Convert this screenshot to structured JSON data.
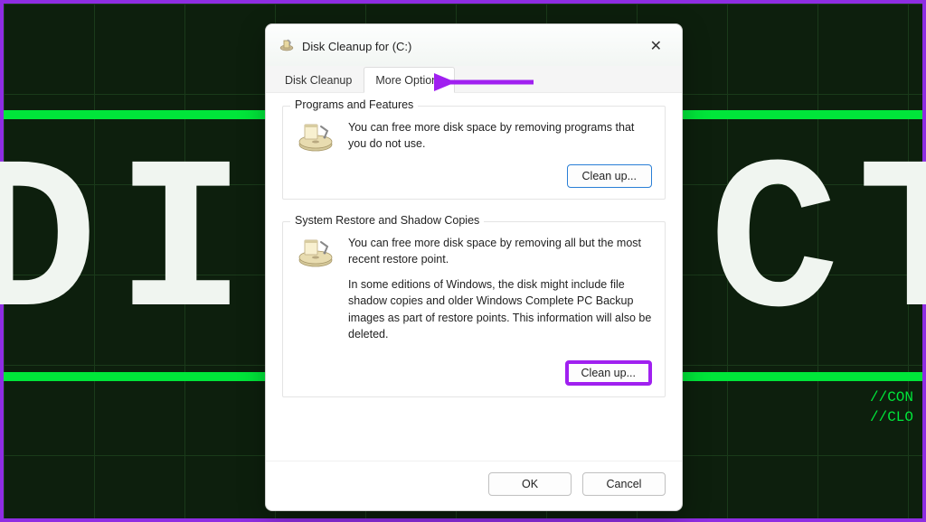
{
  "background": {
    "text_large": "DISC   CTE",
    "side_line1": "//CON",
    "side_line2": "//CLO"
  },
  "dialog": {
    "title": "Disk Cleanup for  (C:)",
    "tabs": {
      "tab1": "Disk Cleanup",
      "tab2": "More Options"
    },
    "group1": {
      "title": "Programs and Features",
      "text": "You can free more disk space by removing programs that you do not use.",
      "button": "Clean up..."
    },
    "group2": {
      "title": "System Restore and Shadow Copies",
      "text1": "You can free more disk space by removing all but the most recent restore point.",
      "text2": "In some editions of Windows, the disk might include file shadow copies and older Windows Complete PC Backup images as part of restore points. This information will also be deleted.",
      "button": "Clean up..."
    },
    "footer": {
      "ok": "OK",
      "cancel": "Cancel"
    }
  }
}
